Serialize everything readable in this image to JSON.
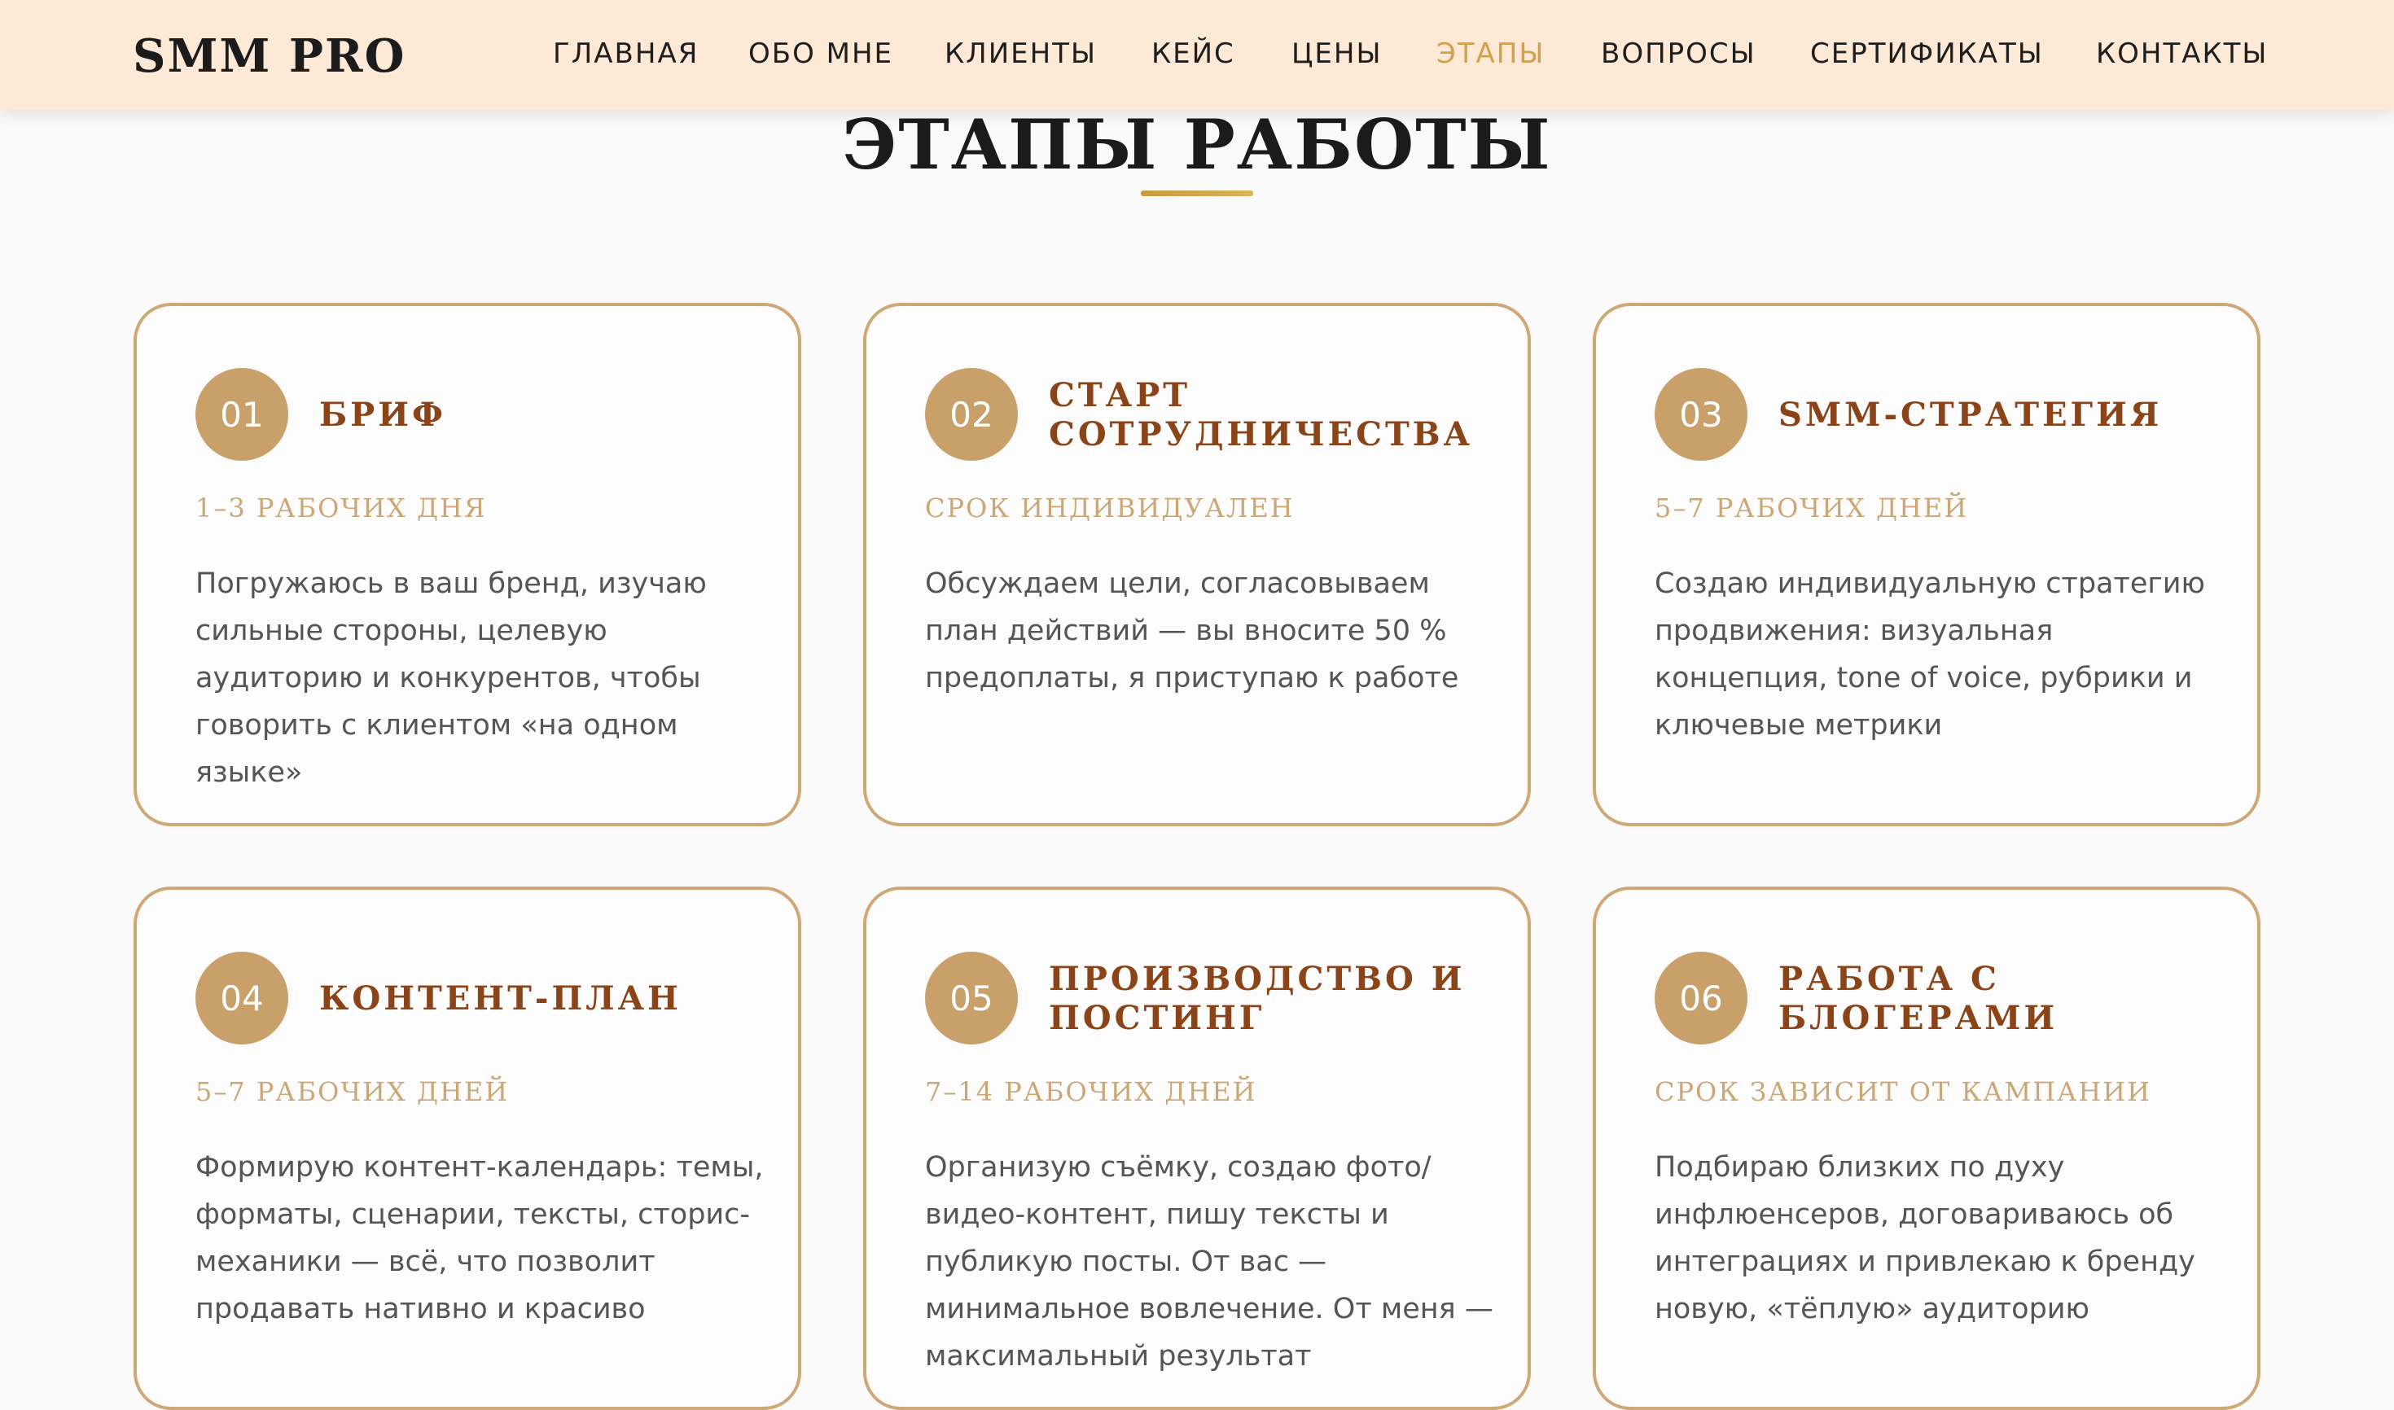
{
  "header": {
    "logo": "SMM PRO",
    "nav": [
      {
        "label": "ГЛАВНАЯ"
      },
      {
        "label": "ОБО МНЕ"
      },
      {
        "label": "КЛИЕНТЫ"
      },
      {
        "label": "КЕЙС"
      },
      {
        "label": "ЦЕНЫ"
      },
      {
        "label": "ЭТАПЫ",
        "active": true
      },
      {
        "label": "ВОПРОСЫ"
      },
      {
        "label": "СЕРТИФИКАТЫ"
      },
      {
        "label": "КОНТАКТЫ"
      }
    ]
  },
  "section": {
    "title": "ЭТАПЫ РАБОТЫ"
  },
  "steps": [
    {
      "number": "01",
      "title": "БРИФ",
      "duration": "1–3 РАБОЧИХ ДНЯ",
      "text": "Погружаюсь в ваш бренд, изучаю сильные стороны, целевую аудиторию и конкурентов, чтобы говорить с клиентом «на одном языке»"
    },
    {
      "number": "02",
      "title": "СТАРТ СОТРУДНИЧЕСТВА",
      "duration": "СРОК ИНДИВИДУАЛЕН",
      "text": "Обсуждаем цели, согласовываем план действий — вы вносите 50 % предоплаты, я приступаю к работе"
    },
    {
      "number": "03",
      "title": "SMM-СТРАТЕГИЯ",
      "duration": "5–7 РАБОЧИХ ДНЕЙ",
      "text": "Создаю индивидуальную стратегию продвижения: визуальная концепция, tone of voice, рубрики и ключевые метрики"
    },
    {
      "number": "04",
      "title": "КОНТЕНТ-ПЛАН",
      "duration": "5–7 РАБОЧИХ ДНЕЙ",
      "text": "Формирую контент-календарь: темы, форматы, сценарии, тексты, сторис-механики — всё, что позволит продавать нативно и красиво"
    },
    {
      "number": "05",
      "title": "ПРОИЗВОДСТВО И ПОСТИНГ",
      "duration": "7–14 РАБОЧИХ ДНЕЙ",
      "text": "Организую съёмку, создаю фото/видео-контент, пишу тексты и публикую посты. От вас — минимальное вовлечение. От меня — максимальный результат"
    },
    {
      "number": "06",
      "title": "РАБОТА С БЛОГЕРАМИ",
      "duration": "СРОК ЗАВИСИТ ОТ КАМПАНИИ",
      "text": "Подбираю близких по духу инфлюенсеров, договариваюсь об интеграциях и привлекаю к бренду новую, «тёплую» аудиторию"
    }
  ],
  "colors": {
    "header_bg": "#fde9d5",
    "accent_gold": "#d2a14a",
    "badge": "#c9a06a",
    "card_border": "#cfa878",
    "card_title": "#8a4418",
    "duration": "#cba776",
    "body_text": "#555555"
  }
}
